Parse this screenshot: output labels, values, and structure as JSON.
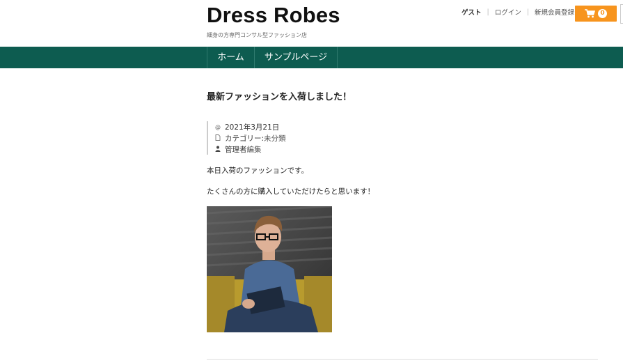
{
  "site": {
    "title": "Dress Robes",
    "tagline": "細身の方専門コンサル型ファッション店"
  },
  "header_links": {
    "guest": "ゲスト",
    "login": "ログイン",
    "register": "新規会員登録"
  },
  "cart": {
    "count": "0",
    "icon": "cart-icon"
  },
  "nav": {
    "home": "ホーム",
    "sample": "サンプルページ"
  },
  "post": {
    "title": "最新ファッションを入荷しました！",
    "date": "2021年3月21日",
    "category_label": "カテゴリー: ",
    "category": "未分類",
    "author": "管理者",
    "edit": "編集",
    "paragraphs": [
      "本日入荷のファッションです。",
      "たくさんの方に購入していただけたらと思います！"
    ]
  },
  "colors": {
    "nav_bg": "#0d5c50",
    "cart_bg": "#f7941d"
  }
}
